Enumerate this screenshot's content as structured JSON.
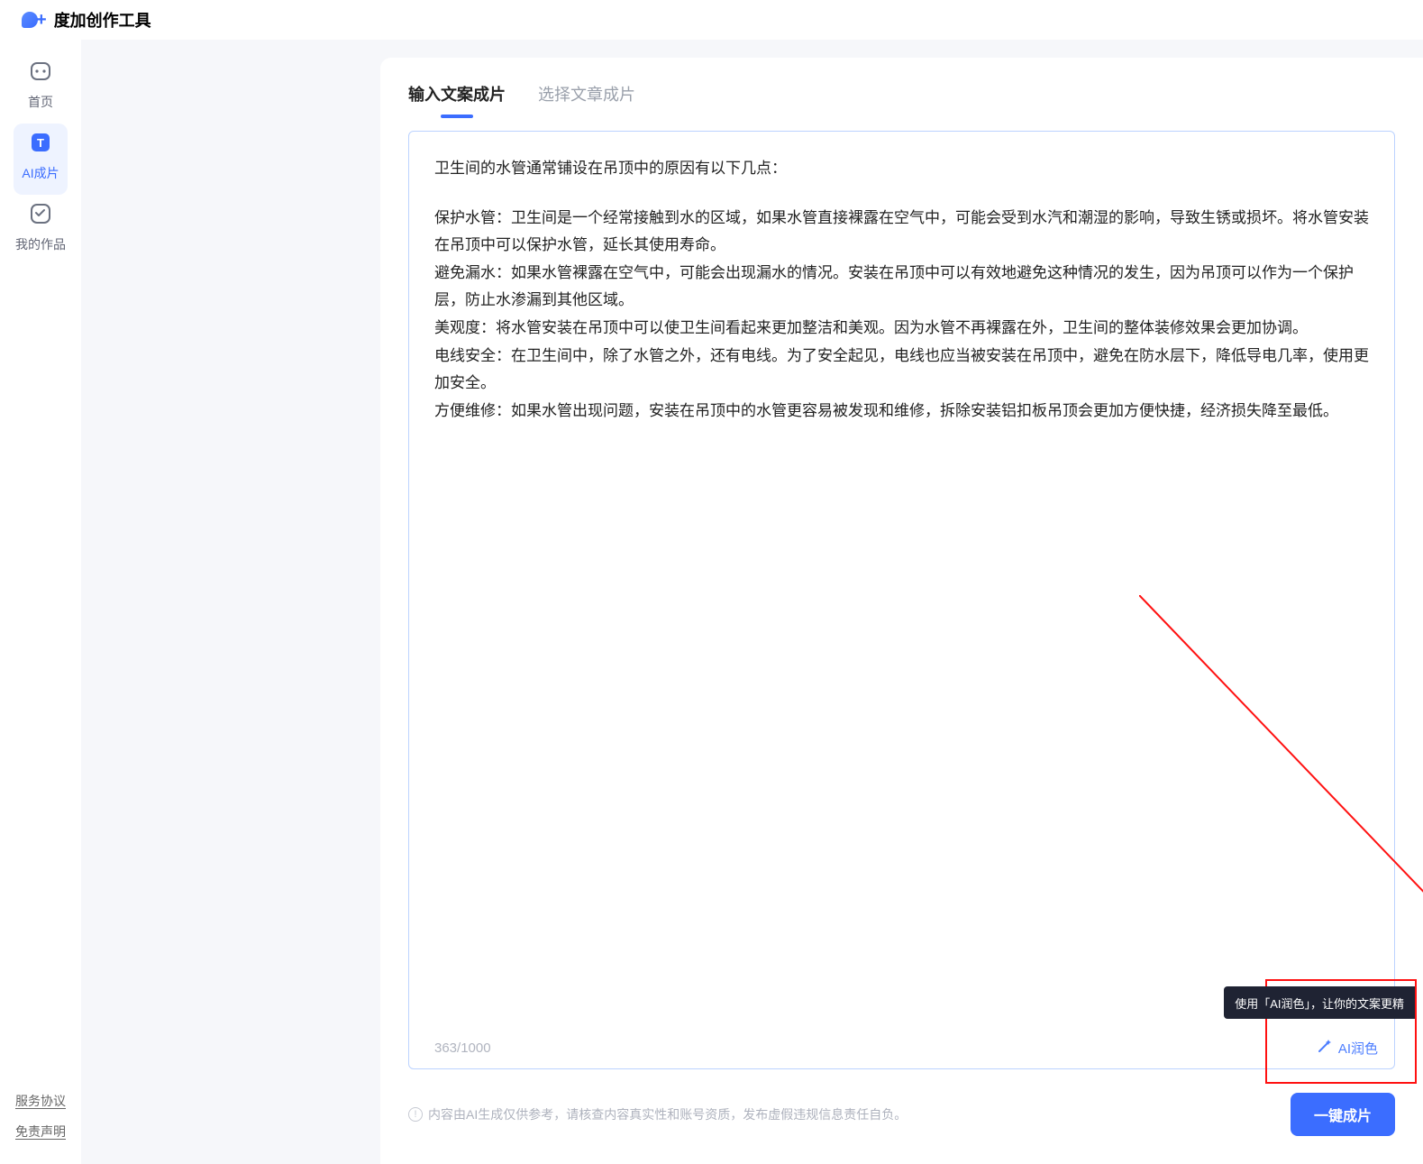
{
  "app": {
    "name": "度加创作工具"
  },
  "sidebar": {
    "items": [
      {
        "label": "首页"
      },
      {
        "label": "AI成片"
      },
      {
        "label": "我的作品"
      }
    ],
    "footer_links": [
      {
        "label": "服务协议"
      },
      {
        "label": "免责声明"
      }
    ]
  },
  "tabs": {
    "active": "输入文案成片",
    "items": [
      {
        "label": "输入文案成片"
      },
      {
        "label": "选择文章成片"
      }
    ]
  },
  "editor": {
    "lines": [
      "卫生间的水管通常铺设在吊顶中的原因有以下几点：",
      "",
      "保护水管：卫生间是一个经常接触到水的区域，如果水管直接裸露在空气中，可能会受到水汽和潮湿的影响，导致生锈或损坏。将水管安装在吊顶中可以保护水管，延长其使用寿命。",
      "避免漏水：如果水管裸露在空气中，可能会出现漏水的情况。安装在吊顶中可以有效地避免这种情况的发生，因为吊顶可以作为一个保护层，防止水渗漏到其他区域。",
      "美观度：将水管安装在吊顶中可以使卫生间看起来更加整洁和美观。因为水管不再裸露在外，卫生间的整体装修效果会更加协调。",
      "电线安全：在卫生间中，除了水管之外，还有电线。为了安全起见，电线也应当被安装在吊顶中，避免在防水层下，降低导电几率，使用更加安全。",
      "方便维修：如果水管出现问题，安装在吊顶中的水管更容易被发现和维修，拆除安装铝扣板吊顶会更加方便快捷，经济损失降至最低。"
    ],
    "counter_current": "363",
    "counter_max": "1000",
    "ai_polish_label": "AI润色",
    "tooltip": "使用「AI润色」，让你的文案更精"
  },
  "footer": {
    "note": "内容由AI生成仅供参考，请核查内容真实性和账号资质，发布虚假违规信息责任自负。",
    "primary_button": "一键成片"
  }
}
